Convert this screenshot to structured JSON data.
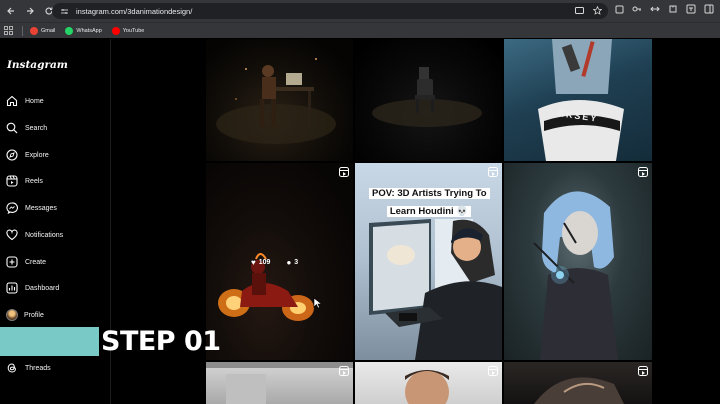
{
  "browser": {
    "url": "instagram.com/3danimationdesign/",
    "bookmarks": [
      {
        "label": "Gmail",
        "color": "#ea4335"
      },
      {
        "label": "WhatsApp",
        "color": "#25d366"
      },
      {
        "label": "YouTube",
        "color": "#ff0000"
      }
    ]
  },
  "sidebar": {
    "logo": "Instagram",
    "items": [
      {
        "label": "Home",
        "icon": "home-icon"
      },
      {
        "label": "Search",
        "icon": "search-icon"
      },
      {
        "label": "Explore",
        "icon": "compass-icon"
      },
      {
        "label": "Reels",
        "icon": "reels-icon"
      },
      {
        "label": "Messages",
        "icon": "messenger-icon"
      },
      {
        "label": "Notifications",
        "icon": "heart-icon"
      },
      {
        "label": "Create",
        "icon": "plus-square-icon"
      },
      {
        "label": "Dashboard",
        "icon": "dashboard-icon"
      },
      {
        "label": "Profile",
        "icon": "avatar"
      },
      {
        "label": "Threads",
        "icon": "threads-icon"
      }
    ]
  },
  "posts": {
    "hover_likes": "109",
    "hover_comments": "3",
    "caption": "POV: 3D Artists Trying To Learn Houdini 💀",
    "jersey_text": "EKSEY"
  },
  "overlay": {
    "step_label": "STEP 01",
    "accent_color": "#79c9c7"
  }
}
